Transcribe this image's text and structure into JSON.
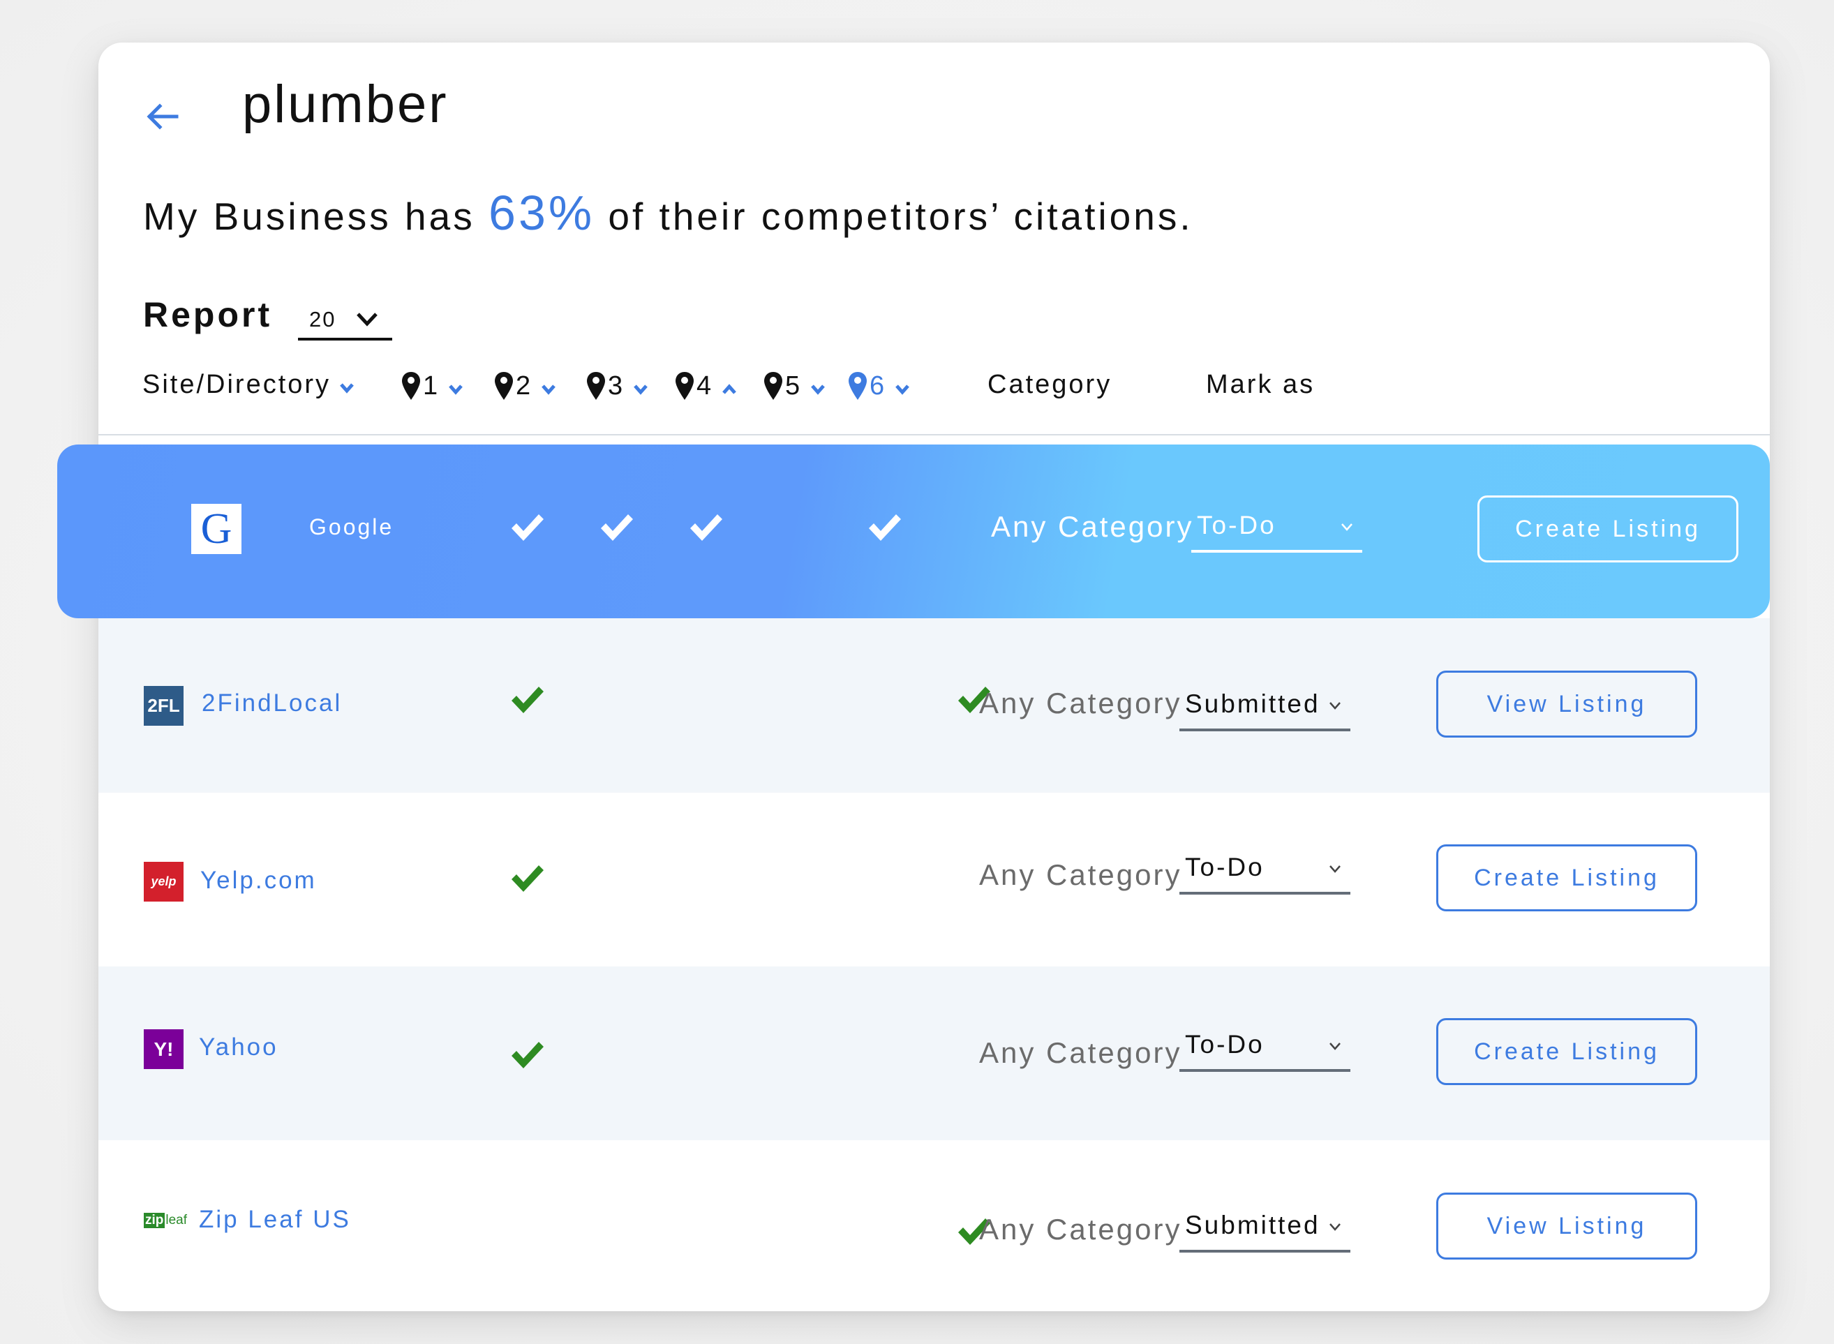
{
  "header": {
    "back_icon": "arrow-left-icon",
    "title": "plumber",
    "summary_prefix": "My Business has ",
    "summary_percent": "63%",
    "summary_suffix": " of their competitors’ citations."
  },
  "report": {
    "label": "Report",
    "selected": "20"
  },
  "columns": {
    "site": "Site/Directory",
    "competitors": [
      {
        "label": "1",
        "sort": "down",
        "highlighted": false
      },
      {
        "label": "2",
        "sort": "down",
        "highlighted": false
      },
      {
        "label": "3",
        "sort": "down",
        "highlighted": false
      },
      {
        "label": "4",
        "sort": "up",
        "highlighted": false
      },
      {
        "label": "5",
        "sort": "down",
        "highlighted": false
      },
      {
        "label": "6",
        "sort": "down",
        "highlighted": true
      }
    ],
    "category": "Category",
    "mark_as": "Mark as"
  },
  "colors": {
    "accent": "#3d7be0",
    "check_green": "#2e8b22",
    "active_row_start": "#5b97fb",
    "active_row_end": "#6bc9fd",
    "alt_row": "#f2f6fa"
  },
  "rows": [
    {
      "site": "Google",
      "logo": "google-logo",
      "checks": [
        1,
        2,
        3,
        5
      ],
      "category": "Any Category",
      "mark_as": "To-Do",
      "action": "Create Listing",
      "active": true
    },
    {
      "site": "2FindLocal",
      "logo": "2findlocal-logo",
      "logo_text": "2FL",
      "checks": [
        1,
        6
      ],
      "category": "Any Category",
      "mark_as": "Submitted",
      "action": "View Listing",
      "active": false
    },
    {
      "site": "Yelp.com",
      "logo": "yelp-logo",
      "logo_text": "yelp",
      "checks": [
        1
      ],
      "category": "Any Category",
      "mark_as": "To-Do",
      "action": "Create Listing",
      "active": false
    },
    {
      "site": "Yahoo",
      "logo": "yahoo-logo",
      "logo_text": "Y!",
      "checks": [
        1
      ],
      "category": "Any Category",
      "mark_as": "To-Do",
      "action": "Create Listing",
      "active": false
    },
    {
      "site": "Zip Leaf US",
      "logo": "zipleaf-logo",
      "logo_text": "zip",
      "logo_text2": "leaf",
      "checks": [
        6
      ],
      "category": "Any Category",
      "mark_as": "Submitted",
      "action": "View Listing",
      "active": false
    }
  ]
}
